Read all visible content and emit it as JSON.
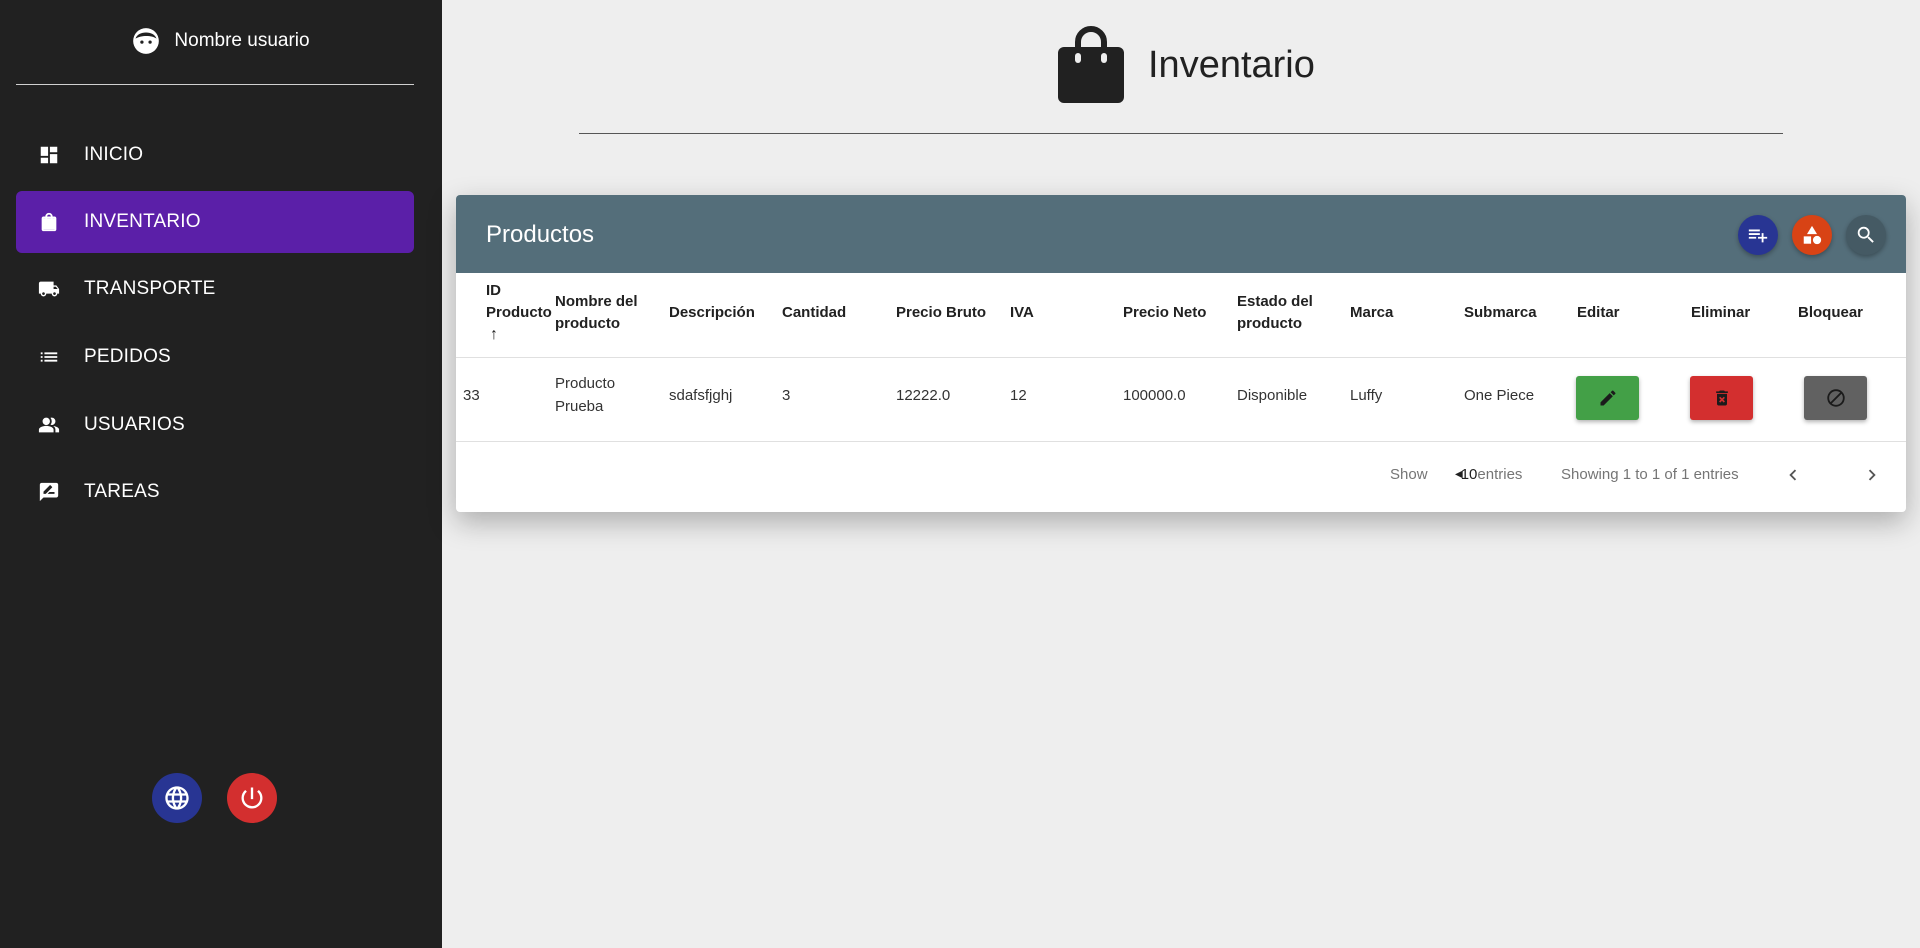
{
  "sidebar": {
    "user_name": "Nombre usuario",
    "items": [
      {
        "label": "INICIO",
        "icon": "dashboard-icon",
        "active": false
      },
      {
        "label": "INVENTARIO",
        "icon": "shopping-bag-icon",
        "active": true
      },
      {
        "label": "TRANSPORTE",
        "icon": "truck-icon",
        "active": false
      },
      {
        "label": "PEDIDOS",
        "icon": "list-icon",
        "active": false
      },
      {
        "label": "USUARIOS",
        "icon": "people-icon",
        "active": false
      },
      {
        "label": "TAREAS",
        "icon": "rate-review-icon",
        "active": false
      }
    ],
    "active_color": "#5b1fa8",
    "language_button_color": "#283593",
    "logout_button_color": "#d32f2f"
  },
  "page": {
    "title": "Inventario",
    "icon": "shopping-bag-icon"
  },
  "table": {
    "title": "Productos",
    "header_color": "#546e7a",
    "header_buttons": [
      {
        "icon": "playlist-add-icon",
        "color": "#283593"
      },
      {
        "icon": "category-icon",
        "color": "#d84315"
      },
      {
        "icon": "search-icon",
        "color": "#455a64"
      }
    ],
    "columns": [
      {
        "line1": "ID",
        "line2": "Producto",
        "sort": "↑"
      },
      {
        "line1": "Nombre del",
        "line2": "producto"
      },
      {
        "line1": "Descripción"
      },
      {
        "line1": "Cantidad"
      },
      {
        "line1": "Precio Bruto"
      },
      {
        "line1": "IVA"
      },
      {
        "line1": "Precio Neto"
      },
      {
        "line1": "Estado del",
        "line2": "producto"
      },
      {
        "line1": "Marca"
      },
      {
        "line1": "Submarca"
      },
      {
        "line1": "Editar"
      },
      {
        "line1": "Eliminar"
      },
      {
        "line1": "Bloquear"
      }
    ],
    "rows": [
      {
        "id": "33",
        "name_line1": "Producto",
        "name_line2": "Prueba",
        "description": "sdafsfjghj",
        "quantity": "3",
        "gross_price": "12222.0",
        "iva": "12",
        "net_price": "100000.0",
        "status": "Disponible",
        "brand": "Luffy",
        "sub_brand": "One Piece"
      }
    ],
    "action_colors": {
      "edit": "#43a047",
      "delete": "#d32f2f",
      "block": "#616161"
    },
    "footer": {
      "show_label": "Show",
      "page_size": "10",
      "entries_label": "entries",
      "info": "Showing 1 to 1 of 1 entries"
    }
  }
}
